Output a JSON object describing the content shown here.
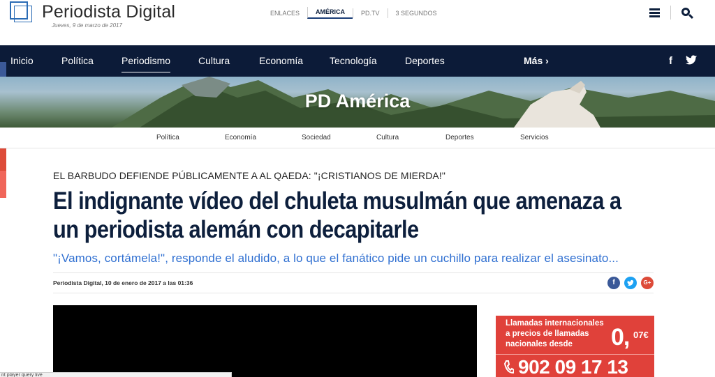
{
  "header": {
    "logo_text": "Periodista Digital",
    "date": "Jueves, 9 de marzo de 2017",
    "top_links": [
      "ENLACES",
      "AMÉRICA",
      "PD.TV",
      "3 SEGUNDOS"
    ]
  },
  "navbar": {
    "items": [
      "Inicio",
      "Política",
      "Periodismo",
      "Cultura",
      "Economía",
      "Tecnología",
      "Deportes",
      "Más ›"
    ],
    "active": "Periodismo",
    "social": [
      "f"
    ]
  },
  "banner": {
    "title": "PD América"
  },
  "subnav": {
    "items": [
      "Política",
      "Economía",
      "Sociedad",
      "Cultura",
      "Deportes",
      "Servicios"
    ]
  },
  "article": {
    "kicker": "EL BARBUDO DEFIENDE PÚBLICAMENTE A AL QAEDA: \"¡CRISTIANOS DE MIERDA!\"",
    "headline_line1": "El indignante vídeo del chuleta musulmán que amenaza a",
    "headline_line2": "un periodista alemán con decapitarle",
    "subtitle": "\"¡Vamos, cortámela!\", responde el aludido, a lo que el fanático pide un cuchillo para realizar el asesinato...",
    "meta": "Periodista Digital, 10 de enero de 2017 a las 01:36",
    "share": [
      "f",
      "G+"
    ]
  },
  "overlay": {
    "text": "nt player query live"
  },
  "ad": {
    "text": "Llamadas internacionales a precios de llamadas nacionales desde",
    "price_int": "0,",
    "price_dec": "07€",
    "phone": "902 09 17 13"
  },
  "colors": {
    "navy": "#0c1b38",
    "headline": "#0d1f3c",
    "subtitle_blue": "#2f6fd1",
    "ad_red": "#e0413a",
    "facebook": "#3b5998",
    "twitter": "#1da1f2",
    "google": "#dd4b39"
  }
}
